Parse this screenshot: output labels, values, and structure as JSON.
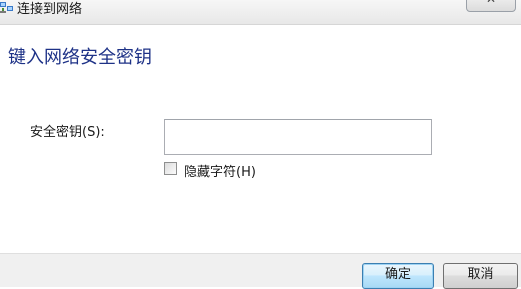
{
  "window": {
    "title": "连接到网络",
    "close_glyph": "✕"
  },
  "heading": "键入网络安全密钥",
  "form": {
    "key_label": "安全密钥(S):",
    "key_value": "",
    "hide_chars_label": "隐藏字符(H)",
    "hide_chars_checked": false
  },
  "buttons": {
    "ok": "确定",
    "cancel": "取消"
  },
  "colors": {
    "heading": "#1e3287",
    "ok_border": "#3c7fb1",
    "footer_bg": "#f0f0f0"
  },
  "icons": {
    "title": "network-connect-icon",
    "close": "close-icon"
  }
}
